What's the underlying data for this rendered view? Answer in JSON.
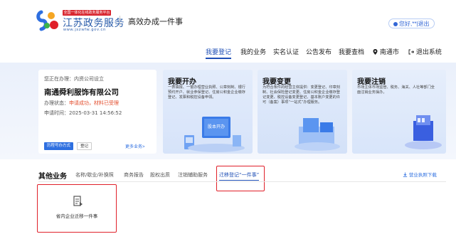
{
  "header": {
    "badge_text": "全国一体化在线政务服务平台",
    "logo_title": "江苏政务服务",
    "logo_url": "www.jszwfw.gov.cn",
    "section_title": "高效办成一件事",
    "user_text": "您好,**|退出"
  },
  "nav": {
    "items": [
      {
        "label": "我要登记",
        "active": true
      },
      {
        "label": "我的业务"
      },
      {
        "label": "实名认证"
      },
      {
        "label": "公告发布"
      },
      {
        "label": "我要查档"
      },
      {
        "label": "南通市",
        "icon": "location-pin-icon"
      },
      {
        "label": "退出系统",
        "icon": "logout-icon"
      }
    ]
  },
  "info_card": {
    "processing_label": "您正在办理：内资公司设立",
    "company_name": "南通舜利服饰有限公司",
    "status_label": "办理状态：",
    "status_value": "申请成功，材料已受理",
    "time_label": "申请时间：2025-03-31 14:56:52",
    "button_primary": "历程号办方式",
    "button_secondary": "登记",
    "more_link": "更多业务>"
  },
  "service_cards": [
    {
      "title": "我要开办",
      "description": "一表填报、一窗办理营业执照、公章刻制、银行预约开户、就业参保登记、住房公积金企业缴存登记、发票和税控设备申领。",
      "art_text": "股本开办"
    },
    {
      "title": "我要变更",
      "description": "为符合条件的经营主体提供：变更登记、印章刻制、社会保险登记变更、住房公积金企业缴存登记变更、税控设备变更登记、基本账户变更的许可（备案）事项“一站式”办理服务。"
    },
    {
      "title": "我要注销",
      "description": "市场主体市场监管、税务、海关、人社等部门全面注销业务操办。"
    }
  ],
  "other_business": {
    "label": "其他业务",
    "tabs": [
      {
        "label": "名称/歇业/补换照"
      },
      {
        "label": "商务报告"
      },
      {
        "label": "股权出质"
      },
      {
        "label": "注销辅助服务"
      },
      {
        "label": "迁移登记“一件事”",
        "active": true
      }
    ],
    "download_label": "营业执照下载",
    "card_label": "省内企业迁移一件事"
  },
  "colors": {
    "accent": "#1f4fb6",
    "highlight": "#e0202a",
    "status": "#e34d2c"
  }
}
